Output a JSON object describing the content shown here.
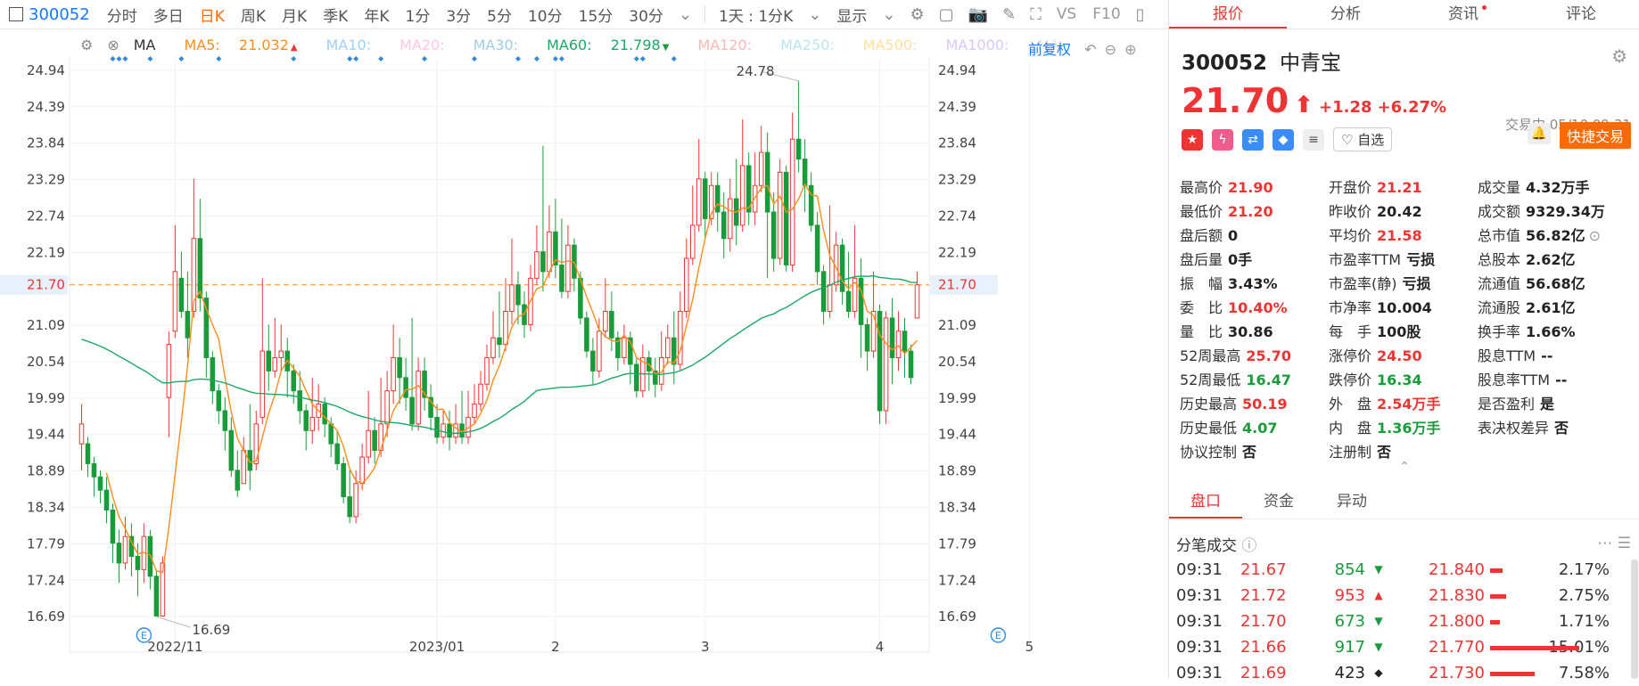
{
  "toolbar": {
    "code": "300052",
    "periods": [
      "分时",
      "多日",
      "日K",
      "周K",
      "月K",
      "季K",
      "年K",
      "1分",
      "3分",
      "5分",
      "10分",
      "15分",
      "30分"
    ],
    "active_period": "日K",
    "interval": "1天 : 1分K",
    "display": "显示",
    "vs_label": "VS",
    "f10_label": "F10"
  },
  "chart": {
    "ma_legend": [
      {
        "label": "MA",
        "value": "",
        "color": "#333333"
      },
      {
        "label": "MA5:",
        "value": "21.032",
        "color": "#ff8c1a",
        "arrow": "▲"
      },
      {
        "label": "MA10:",
        "value": "",
        "color": "#9ecfff"
      },
      {
        "label": "MA20:",
        "value": "",
        "color": "#ffc7e0"
      },
      {
        "label": "MA30:",
        "value": "",
        "color": "#9ecfe5"
      },
      {
        "label": "MA60:",
        "value": "21.798",
        "color": "#1aa867",
        "arrow": "▼"
      },
      {
        "label": "MA120:",
        "value": "",
        "color": "#ffb6b6"
      },
      {
        "label": "MA250:",
        "value": "",
        "color": "#b8e6f0"
      },
      {
        "label": "MA500:",
        "value": "",
        "color": "#ffe0a0"
      },
      {
        "label": "MA1000:",
        "value": "",
        "color": "#d8c8ff"
      },
      {
        "label": "MA",
        "value": "",
        "color": "#e6e6e6"
      }
    ],
    "fuquan": "前复权",
    "current_price_label": "21.70",
    "high_label": "24.78",
    "low_label": "16.69",
    "e_marker": "E"
  },
  "chart_data": {
    "type": "candlestick",
    "y_ticks": [
      24.94,
      24.39,
      23.84,
      23.29,
      22.74,
      22.19,
      21.7,
      21.09,
      20.54,
      19.99,
      19.44,
      18.89,
      18.34,
      17.79,
      17.24,
      16.69
    ],
    "x_ticks": [
      {
        "label": "2022/11",
        "index": 15
      },
      {
        "label": "2023/01",
        "index": 57
      },
      {
        "label": "2",
        "index": 76
      },
      {
        "label": "3",
        "index": 100
      },
      {
        "label": "4",
        "index": 128
      },
      {
        "label": "5",
        "index": 152
      }
    ],
    "ylim": [
      16.45,
      25.1
    ],
    "highest": 24.78,
    "lowest": 16.69,
    "last_price": 21.7,
    "ma5_last": 21.032,
    "ma60_last": 21.798,
    "candles": [
      [
        19.3,
        19.6,
        18.9,
        19.9
      ],
      [
        19.3,
        19.0,
        18.8,
        19.4
      ],
      [
        19.0,
        18.8,
        18.5,
        19.1
      ],
      [
        18.8,
        18.6,
        18.4,
        18.9
      ],
      [
        18.6,
        18.3,
        18.1,
        18.8
      ],
      [
        18.3,
        17.8,
        17.5,
        18.4
      ],
      [
        17.8,
        17.5,
        17.2,
        18.0
      ],
      [
        17.5,
        17.9,
        17.4,
        18.2
      ],
      [
        17.9,
        17.6,
        17.3,
        18.1
      ],
      [
        17.6,
        17.4,
        17.0,
        17.8
      ],
      [
        17.4,
        17.9,
        17.2,
        18.1
      ],
      [
        17.9,
        17.3,
        17.1,
        18.0
      ],
      [
        17.3,
        16.7,
        16.69,
        17.4
      ],
      [
        16.7,
        17.5,
        16.69,
        17.6
      ],
      [
        20.0,
        20.8,
        19.4,
        21.0
      ],
      [
        21.0,
        21.9,
        20.9,
        22.6
      ],
      [
        21.8,
        21.3,
        21.2,
        22.2
      ],
      [
        21.3,
        20.9,
        20.6,
        21.9
      ],
      [
        21.3,
        22.4,
        21.2,
        23.3
      ],
      [
        22.4,
        21.5,
        21.3,
        23.0
      ],
      [
        21.5,
        20.6,
        20.3,
        21.6
      ],
      [
        20.6,
        20.1,
        19.9,
        20.7
      ],
      [
        20.1,
        19.8,
        19.6,
        20.2
      ],
      [
        19.8,
        19.5,
        19.2,
        20.0
      ],
      [
        19.5,
        18.9,
        18.8,
        19.7
      ],
      [
        18.9,
        18.6,
        18.5,
        19.2
      ],
      [
        18.7,
        19.2,
        18.7,
        19.4
      ],
      [
        19.2,
        18.9,
        18.6,
        19.9
      ],
      [
        19.0,
        19.6,
        18.9,
        19.8
      ],
      [
        19.7,
        20.7,
        19.6,
        21.8
      ],
      [
        20.7,
        20.4,
        20.1,
        21.1
      ],
      [
        20.4,
        20.6,
        20.3,
        21.2
      ],
      [
        20.6,
        20.7,
        20.4,
        21.1
      ],
      [
        20.7,
        20.4,
        20.0,
        20.9
      ],
      [
        20.4,
        20.1,
        19.9,
        20.5
      ],
      [
        20.1,
        19.8,
        19.6,
        20.4
      ],
      [
        19.8,
        19.5,
        19.2,
        19.9
      ],
      [
        19.5,
        19.7,
        19.3,
        20.3
      ],
      [
        19.7,
        19.9,
        19.5,
        20.2
      ],
      [
        19.9,
        19.6,
        19.4,
        20.0
      ],
      [
        19.6,
        19.3,
        19.1,
        19.7
      ],
      [
        19.3,
        19.0,
        18.9,
        19.5
      ],
      [
        19.0,
        18.5,
        18.4,
        19.1
      ],
      [
        18.5,
        18.2,
        18.1,
        18.9
      ],
      [
        18.2,
        18.7,
        18.1,
        18.9
      ],
      [
        18.7,
        19.1,
        18.6,
        19.3
      ],
      [
        19.1,
        19.5,
        19.0,
        20.1
      ],
      [
        19.5,
        19.2,
        19.0,
        19.7
      ],
      [
        19.2,
        19.6,
        19.1,
        20.3
      ],
      [
        19.6,
        20.1,
        19.4,
        20.4
      ],
      [
        20.1,
        20.6,
        19.9,
        21.1
      ],
      [
        20.6,
        20.3,
        19.9,
        20.9
      ],
      [
        20.3,
        20.0,
        19.8,
        20.6
      ],
      [
        20.0,
        19.6,
        19.5,
        21.2
      ],
      [
        19.6,
        20.4,
        19.5,
        20.6
      ],
      [
        20.4,
        20.0,
        19.8,
        20.6
      ],
      [
        20.0,
        19.7,
        19.5,
        20.2
      ],
      [
        19.7,
        19.4,
        19.3,
        19.9
      ],
      [
        19.4,
        19.6,
        19.3,
        19.8
      ],
      [
        19.6,
        19.4,
        19.2,
        19.8
      ],
      [
        19.4,
        19.6,
        19.3,
        19.9
      ],
      [
        19.6,
        19.4,
        19.3,
        20.1
      ],
      [
        19.4,
        19.7,
        19.3,
        20.1
      ],
      [
        19.7,
        19.9,
        19.6,
        20.2
      ],
      [
        19.9,
        20.2,
        19.8,
        20.4
      ],
      [
        20.2,
        20.6,
        20.1,
        20.8
      ],
      [
        20.6,
        20.9,
        20.5,
        21.3
      ],
      [
        20.9,
        20.8,
        20.6,
        21.6
      ],
      [
        20.8,
        21.3,
        20.7,
        21.8
      ],
      [
        21.3,
        21.7,
        21.1,
        22.4
      ],
      [
        21.7,
        21.4,
        21.1,
        21.9
      ],
      [
        21.4,
        21.1,
        20.9,
        21.6
      ],
      [
        21.1,
        21.8,
        21.0,
        22.0
      ],
      [
        21.8,
        22.2,
        21.7,
        22.6
      ],
      [
        22.2,
        21.9,
        21.6,
        23.8
      ],
      [
        21.9,
        22.5,
        21.8,
        22.9
      ],
      [
        22.5,
        22.0,
        21.8,
        23.0
      ],
      [
        22.0,
        21.6,
        21.5,
        22.7
      ],
      [
        21.6,
        22.3,
        21.5,
        22.6
      ],
      [
        22.3,
        21.8,
        21.6,
        22.4
      ],
      [
        21.8,
        21.2,
        21.1,
        21.9
      ],
      [
        21.2,
        20.7,
        20.6,
        21.3
      ],
      [
        20.7,
        20.4,
        20.2,
        20.9
      ],
      [
        20.4,
        21.0,
        20.3,
        21.2
      ],
      [
        21.0,
        21.3,
        20.9,
        21.8
      ],
      [
        21.3,
        20.9,
        20.7,
        21.6
      ],
      [
        20.9,
        20.6,
        20.4,
        21.0
      ],
      [
        20.6,
        20.9,
        20.5,
        21.1
      ],
      [
        20.9,
        20.5,
        20.2,
        21.0
      ],
      [
        20.5,
        20.1,
        20.0,
        20.6
      ],
      [
        20.1,
        20.6,
        20.0,
        20.8
      ],
      [
        20.6,
        20.4,
        20.1,
        20.7
      ],
      [
        20.4,
        20.2,
        20.0,
        20.6
      ],
      [
        20.2,
        20.6,
        20.1,
        21.0
      ],
      [
        20.6,
        20.9,
        20.5,
        21.1
      ],
      [
        20.9,
        20.5,
        20.2,
        21.3
      ],
      [
        20.5,
        21.3,
        20.4,
        21.6
      ],
      [
        21.3,
        22.1,
        21.2,
        22.4
      ],
      [
        22.1,
        22.6,
        22.0,
        23.2
      ],
      [
        22.6,
        23.3,
        22.5,
        23.9
      ],
      [
        23.3,
        22.7,
        22.4,
        23.4
      ],
      [
        22.7,
        23.2,
        22.6,
        23.4
      ],
      [
        23.2,
        22.8,
        22.5,
        23.4
      ],
      [
        22.8,
        22.4,
        22.1,
        23.1
      ],
      [
        22.4,
        23.0,
        22.2,
        23.3
      ],
      [
        23.0,
        22.6,
        22.3,
        23.6
      ],
      [
        22.6,
        23.5,
        22.5,
        24.2
      ],
      [
        23.5,
        22.8,
        22.6,
        23.7
      ],
      [
        22.8,
        23.2,
        22.6,
        23.7
      ],
      [
        23.2,
        23.7,
        23.1,
        24.1
      ],
      [
        23.7,
        22.8,
        21.8,
        24.0
      ],
      [
        22.8,
        22.1,
        21.9,
        23.1
      ],
      [
        22.1,
        23.4,
        22.0,
        23.6
      ],
      [
        23.4,
        22.0,
        21.9,
        23.5
      ],
      [
        22.0,
        23.9,
        21.9,
        24.3
      ],
      [
        23.9,
        23.6,
        23.4,
        24.78
      ],
      [
        23.6,
        23.2,
        22.8,
        23.9
      ],
      [
        23.2,
        22.6,
        22.5,
        23.4
      ],
      [
        22.6,
        21.9,
        21.7,
        22.8
      ],
      [
        21.9,
        21.3,
        21.1,
        22.0
      ],
      [
        21.3,
        21.7,
        21.2,
        22.9
      ],
      [
        21.7,
        22.3,
        21.6,
        22.5
      ],
      [
        22.3,
        21.6,
        21.4,
        22.4
      ],
      [
        21.6,
        21.3,
        21.2,
        22.2
      ],
      [
        21.3,
        21.8,
        21.2,
        22.6
      ],
      [
        21.8,
        21.1,
        20.6,
        22.1
      ],
      [
        21.1,
        20.7,
        20.4,
        21.2
      ],
      [
        20.7,
        21.3,
        20.6,
        21.9
      ],
      [
        21.3,
        19.8,
        19.6,
        21.4
      ],
      [
        19.8,
        21.2,
        19.6,
        21.3
      ],
      [
        21.2,
        20.6,
        20.2,
        21.5
      ],
      [
        20.6,
        21.0,
        20.4,
        21.3
      ],
      [
        21.0,
        20.7,
        20.3,
        21.2
      ],
      [
        20.7,
        20.3,
        20.2,
        20.8
      ],
      [
        21.2,
        21.7,
        21.2,
        21.9
      ]
    ]
  },
  "right_panel": {
    "tabs": [
      "报价",
      "分析",
      "资讯",
      "评论"
    ],
    "active_tab": "报价",
    "code": "300052",
    "name": "中青宝",
    "price": "21.70",
    "arrow": "⬆",
    "change": "+1.28",
    "change_pct": "+6.27%",
    "trade_time": "交易中 05/10 09:31",
    "zixuan": "自选",
    "quick_trade": "快捷交易",
    "stats": [
      {
        "label": "最高价",
        "value": "21.90",
        "cls": "up"
      },
      {
        "label": "开盘价",
        "value": "21.21",
        "cls": "up"
      },
      {
        "label": "成交量",
        "value": "4.32万手",
        "cls": "nt"
      },
      {
        "label": "最低价",
        "value": "21.20",
        "cls": "up"
      },
      {
        "label": "昨收价",
        "value": "20.42",
        "cls": "nt"
      },
      {
        "label": "成交额",
        "value": "9329.34万",
        "cls": "nt"
      },
      {
        "label": "盘后额",
        "value": "0",
        "cls": "nt"
      },
      {
        "label": "平均价",
        "value": "21.58",
        "cls": "up"
      },
      {
        "label": "总市值",
        "value": "56.82亿",
        "cls": "nt"
      },
      {
        "label": "盘后量",
        "value": "0手",
        "cls": "nt"
      },
      {
        "label": "市盈率TTM",
        "value": "亏损",
        "cls": "nt"
      },
      {
        "label": "总股本",
        "value": "2.62亿",
        "cls": "nt"
      },
      {
        "label": "振　幅",
        "value": "3.43%",
        "cls": "nt"
      },
      {
        "label": "市盈率(静)",
        "value": "亏损",
        "cls": "nt"
      },
      {
        "label": "流通值",
        "value": "56.68亿",
        "cls": "nt"
      },
      {
        "label": "委　比",
        "value": "10.40%",
        "cls": "up"
      },
      {
        "label": "市净率",
        "value": "10.004",
        "cls": "nt"
      },
      {
        "label": "流通股",
        "value": "2.61亿",
        "cls": "nt"
      },
      {
        "label": "量　比",
        "value": "30.86",
        "cls": "nt"
      },
      {
        "label": "每　手",
        "value": "100股",
        "cls": "nt"
      },
      {
        "label": "换手率",
        "value": "1.66%",
        "cls": "nt"
      },
      {
        "label": "52周最高",
        "value": "25.70",
        "cls": "up"
      },
      {
        "label": "涨停价",
        "value": "24.50",
        "cls": "up"
      },
      {
        "label": "股息TTM",
        "value": "--",
        "cls": "nt"
      },
      {
        "label": "52周最低",
        "value": "16.47",
        "cls": "dn"
      },
      {
        "label": "跌停价",
        "value": "16.34",
        "cls": "dn"
      },
      {
        "label": "股息率TTM",
        "value": "--",
        "cls": "nt"
      },
      {
        "label": "历史最高",
        "value": "50.19",
        "cls": "up"
      },
      {
        "label": "外　盘",
        "value": "2.54万手",
        "cls": "up"
      },
      {
        "label": "是否盈利",
        "value": "是",
        "cls": "nt"
      },
      {
        "label": "历史最低",
        "value": "4.07",
        "cls": "dn"
      },
      {
        "label": "内　盘",
        "value": "1.36万手",
        "cls": "dn"
      },
      {
        "label": "表决权差异",
        "value": "否",
        "cls": "nt"
      },
      {
        "label": "协议控制",
        "value": "否",
        "cls": "nt"
      },
      {
        "label": "注册制",
        "value": "否",
        "cls": "nt"
      },
      {
        "label": "",
        "value": "",
        "cls": "nt"
      }
    ],
    "subtabs": [
      "盘口",
      "资金",
      "异动"
    ],
    "active_subtab": "盘口",
    "tick_title": "分笔成交",
    "ticks": [
      {
        "time": "09:31",
        "price": "21.67",
        "vol": "854",
        "dir": "dn"
      },
      {
        "time": "09:31",
        "price": "21.72",
        "vol": "953",
        "dir": "up"
      },
      {
        "time": "09:31",
        "price": "21.70",
        "vol": "673",
        "dir": "dn"
      },
      {
        "time": "09:31",
        "price": "21.66",
        "vol": "917",
        "dir": "dn"
      },
      {
        "time": "09:31",
        "price": "21.69",
        "vol": "423",
        "dir": "nt"
      }
    ],
    "levels": [
      {
        "price": "21.840",
        "pct": "2.17%",
        "frac": 0.14
      },
      {
        "price": "21.830",
        "pct": "2.75%",
        "frac": 0.18
      },
      {
        "price": "21.800",
        "pct": "1.71%",
        "frac": 0.11
      },
      {
        "price": "21.770",
        "pct": "15.01%",
        "frac": 1.0
      },
      {
        "price": "21.730",
        "pct": "7.58%",
        "frac": 0.5
      }
    ]
  }
}
